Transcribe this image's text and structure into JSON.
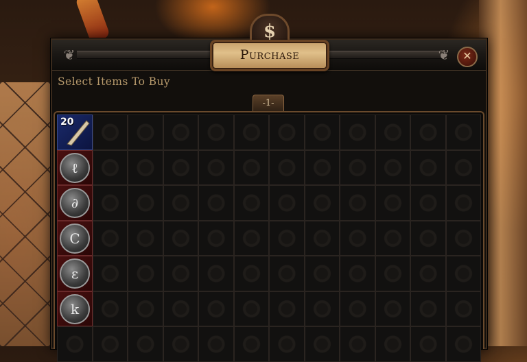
{
  "window": {
    "title": "Purchase",
    "medallion_glyph": "$",
    "close_glyph": "✕",
    "subtitle": "Select Items To Buy"
  },
  "tabs": [
    {
      "label": "-1-"
    }
  ],
  "grid": {
    "columns": 12,
    "rows": 7,
    "items": [
      {
        "row": 0,
        "col": 0,
        "quantity": "20",
        "kind": "scroll-fragment",
        "icon": "scroll-shard-icon"
      },
      {
        "row": 1,
        "col": 0,
        "kind": "orb",
        "icon": "orb-icon",
        "glyph": "ℓ"
      },
      {
        "row": 2,
        "col": 0,
        "kind": "orb",
        "icon": "orb-icon",
        "glyph": "∂"
      },
      {
        "row": 3,
        "col": 0,
        "kind": "orb",
        "icon": "orb-icon",
        "glyph": "C"
      },
      {
        "row": 4,
        "col": 0,
        "kind": "orb",
        "icon": "orb-icon",
        "glyph": "ε"
      },
      {
        "row": 5,
        "col": 0,
        "kind": "orb",
        "icon": "orb-icon",
        "glyph": "k"
      }
    ]
  },
  "colors": {
    "panel_background": "#120f0c",
    "frame_brown": "#6a4a2c",
    "subtitle_text": "#b79a6c",
    "slot_blue": "#1a2a6a",
    "slot_red": "#4a1010"
  }
}
